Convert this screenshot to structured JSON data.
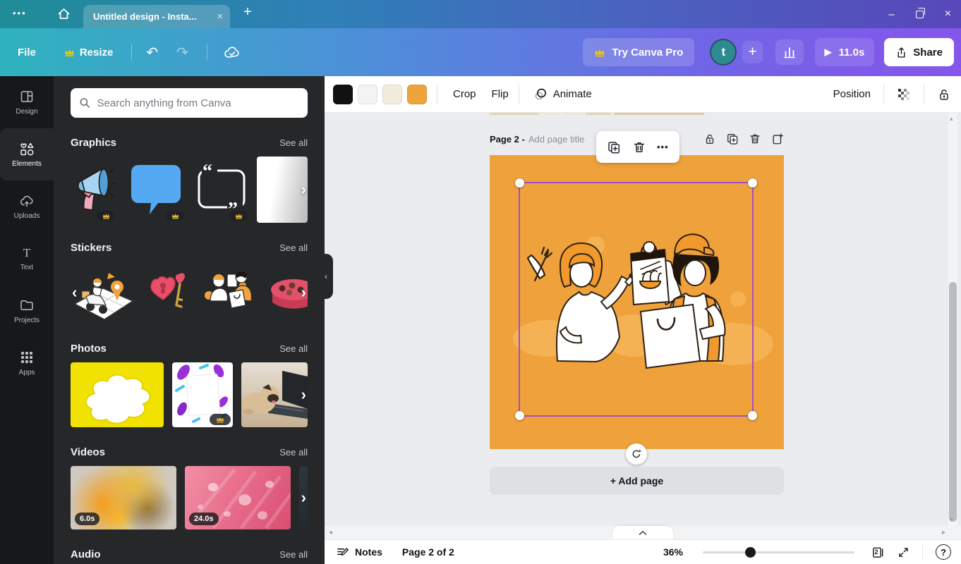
{
  "colors": {
    "accent_orange": "#EFA23B",
    "selection_purple": "#A64CC4",
    "topbar_teal": "#2FB3BE",
    "topbar_purple": "#8655EC",
    "rail_dark": "#17181A",
    "panel_dark": "#252729",
    "canvas_bg": "#EBECEF"
  },
  "titlebar": {
    "menu_dots": "•••",
    "tab_label": "Untitled design - Insta...",
    "close_tab": "×",
    "new_tab": "+",
    "win_minimize": "–"
  },
  "menubar": {
    "file_label": "File",
    "resize_label": "Resize",
    "undo": "↶",
    "redo": "↷",
    "try_pro_label": "Try Canva Pro",
    "avatar_initial": "t",
    "new_design": "+",
    "play": "▶",
    "play_duration": "11.0s",
    "share_label": "Share"
  },
  "toolbar": {
    "swatches": [
      "#111111",
      "#F2F3F5",
      "#F3EBDC",
      "#EFA33C"
    ],
    "crop_label": "Crop",
    "flip_label": "Flip",
    "animate_label": "Animate",
    "position_label": "Position"
  },
  "rail": {
    "items": [
      {
        "label": "Design"
      },
      {
        "label": "Elements"
      },
      {
        "label": "Uploads"
      },
      {
        "label": "Text"
      },
      {
        "label": "Projects"
      },
      {
        "label": "Apps"
      }
    ]
  },
  "panel": {
    "search_placeholder": "Search anything from Canva",
    "sections": {
      "graphics": {
        "title": "Graphics",
        "see_all": "See all"
      },
      "stickers": {
        "title": "Stickers",
        "see_all": "See all"
      },
      "photos": {
        "title": "Photos",
        "see_all": "See all"
      },
      "videos": {
        "title": "Videos",
        "see_all": "See all"
      },
      "audio": {
        "title": "Audio",
        "see_all": "See all"
      }
    },
    "videos_row": {
      "durations": [
        "6.0s",
        "24.0s"
      ]
    },
    "chevron_right": "›",
    "chevron_left": "‹"
  },
  "canvas": {
    "page_label": "Page 2 -",
    "page_title_placeholder": "Add page title",
    "add_page_label": "+ Add page",
    "more_dots": "•••"
  },
  "statusbar": {
    "notes_label": "Notes",
    "page_indicator": "Page 2 of 2",
    "zoom_level": "36%",
    "pages_count": "2",
    "help": "?"
  }
}
